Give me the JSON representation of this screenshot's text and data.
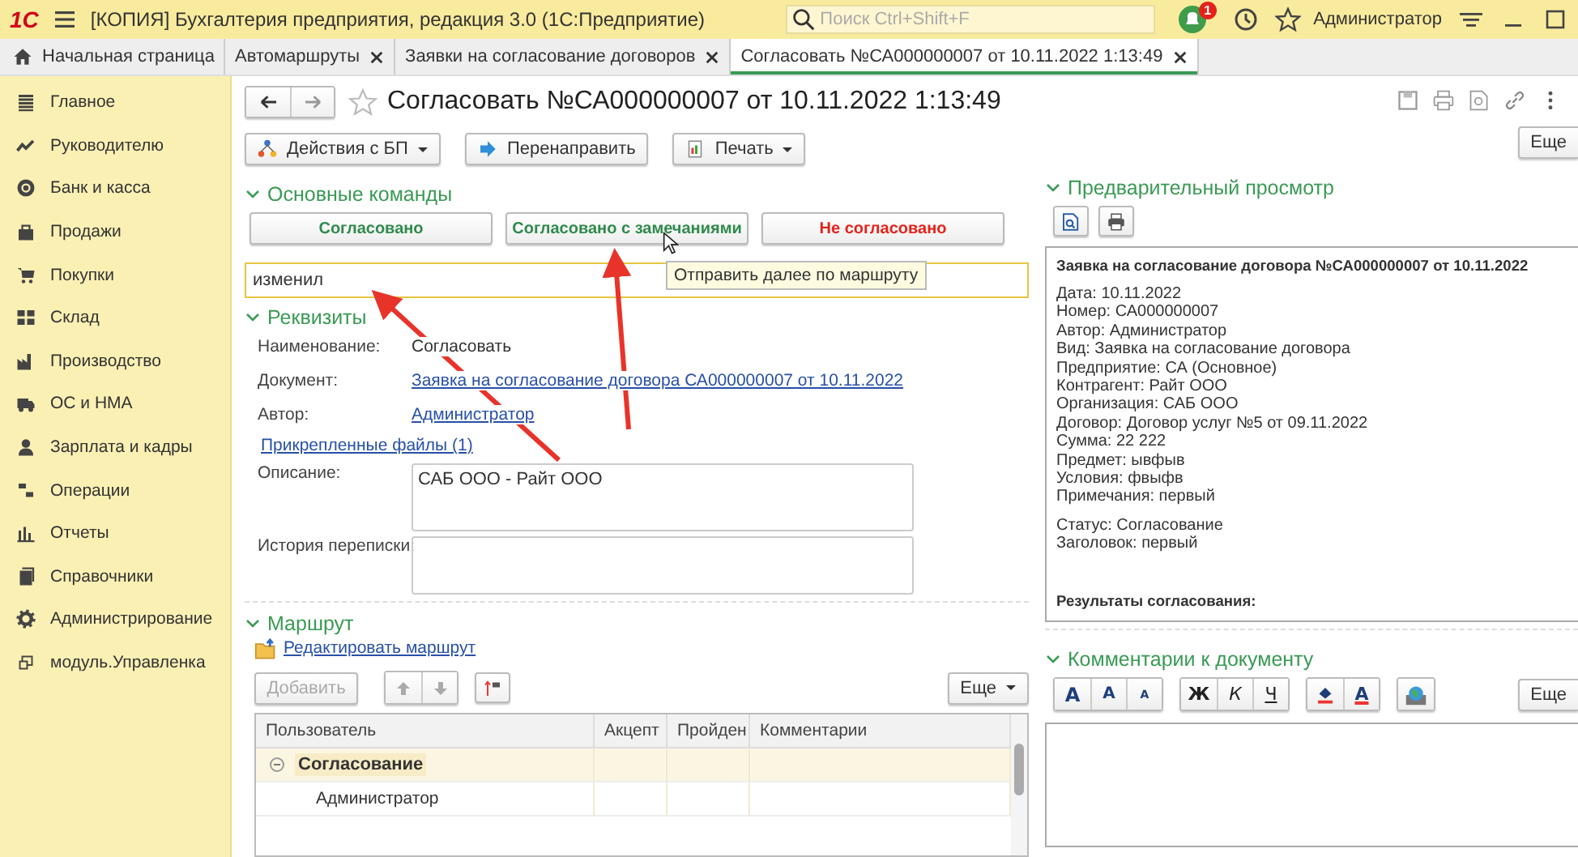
{
  "app": {
    "logo": "1С",
    "title": "[КОПИЯ] Бухгалтерия предприятия, редакция 3.0  (1С:Предприятие)",
    "search_placeholder": "Поиск Ctrl+Shift+F",
    "notifications": "1",
    "user": "Администратор"
  },
  "tabs": [
    {
      "label": "Начальная страница",
      "kind": "home",
      "selected": false
    },
    {
      "label": "Автомаршруты",
      "kind": "closable",
      "selected": false
    },
    {
      "label": "Заявки на согласование договоров",
      "kind": "closable",
      "selected": false
    },
    {
      "label": "Согласовать №СА000000007 от 10.11.2022 1:13:49",
      "kind": "closable",
      "selected": true
    }
  ],
  "sidebar": {
    "items": [
      {
        "label": "Главное",
        "kind": "list"
      },
      {
        "label": "Руководителю",
        "kind": "trend"
      },
      {
        "label": "Банк и касса",
        "kind": "coin"
      },
      {
        "label": "Продажи",
        "kind": "bag"
      },
      {
        "label": "Покупки",
        "kind": "cart"
      },
      {
        "label": "Склад",
        "kind": "grid"
      },
      {
        "label": "Производство",
        "kind": "factory"
      },
      {
        "label": "ОС и НМА",
        "kind": "truck"
      },
      {
        "label": "Зарплата и кадры",
        "kind": "person"
      },
      {
        "label": "Операции",
        "kind": "ledger"
      },
      {
        "label": "Отчеты",
        "kind": "chart"
      },
      {
        "label": "Справочники",
        "kind": "book"
      },
      {
        "label": "Администрирование",
        "kind": "gear"
      },
      {
        "label": "модуль.Управленка",
        "kind": "module"
      }
    ]
  },
  "form": {
    "title": "Согласовать №СА000000007 от 10.11.2022 1:13:49",
    "actions": [
      {
        "label": "Действия с БП",
        "kind": "bp",
        "dropdown": true
      },
      {
        "label": "Перенаправить",
        "kind": "redirect",
        "dropdown": false
      },
      {
        "label": "Печать",
        "kind": "print",
        "dropdown": true
      }
    ],
    "main_commands": {
      "header": "Основные команды",
      "buttons": [
        {
          "label": "Согласовано",
          "color": "#2f8a4c"
        },
        {
          "label": "Согласовано с замечаниями",
          "color": "#2f8a4c"
        },
        {
          "label": "Не согласовано",
          "color": "#e3231b"
        }
      ],
      "tooltip": "Отправить далее по маршруту"
    },
    "comment_field": {
      "value": "изменил"
    },
    "details": {
      "header": "Реквизиты",
      "fields": [
        {
          "label": "Наименование:",
          "value": "Согласовать",
          "kind": "text"
        },
        {
          "label": "Документ:",
          "value": "Заявка на согласование договора СА000000007 от 10.11.2022",
          "kind": "link"
        },
        {
          "label": "Автор:",
          "value": "Администратор",
          "kind": "link"
        }
      ],
      "attachments_link": "Прикрепленные файлы (1)",
      "description": {
        "label": "Описание:",
        "value": "САБ ООО - Райт ООО"
      },
      "history": {
        "label": "История переписки:"
      }
    },
    "route": {
      "header": "Маршрут",
      "edit_link": "Редактировать маршрут",
      "add_button": {
        "label": "Добавить",
        "disabled": true
      },
      "more_button": "Еще",
      "columns": [
        "Пользователь",
        "Акцепт",
        "Пройден",
        "Комментарии"
      ],
      "rows": [
        {
          "label": "Согласование",
          "expanded": true,
          "children": [
            {
              "label": "Администратор"
            }
          ]
        }
      ]
    }
  },
  "side": {
    "more_button": "Еще",
    "preview": {
      "header": "Предварительный просмотр",
      "title": "Заявка на согласование договора №СА000000007 от 10.11.2022",
      "lines": [
        "Дата: 10.11.2022",
        "Номер: СА000000007",
        "Автор: Администратор",
        "Вид: Заявка на согласование договора",
        "Предприятие: СА (Основное)",
        "Контрагент: Райт ООО",
        "Организация: САБ ООО",
        "Договор: Договор услуг №5 от 09.11.2022",
        "Сумма: 22 222",
        "Предмет: ывфыв",
        "Условия: фвыфв",
        "Примечания: первый"
      ],
      "status_lines": [
        "Статус: Согласование",
        "Заголовок: первый"
      ],
      "results": "Результаты согласования:"
    },
    "comments": {
      "header": "Комментарии к документу",
      "format_groups": [
        {
          "buttons": [
            {
              "label": "A",
              "kind": "font"
            },
            {
              "label": "A",
              "kind": "grow"
            },
            {
              "label": "A",
              "kind": "shrink"
            }
          ]
        },
        {
          "buttons": [
            {
              "label": "Ж",
              "kind": "bold"
            },
            {
              "label": "К",
              "kind": "italic"
            },
            {
              "label": "Ч",
              "kind": "underline"
            }
          ]
        },
        {
          "buttons": [
            {
              "kind": "fill"
            },
            {
              "label": "A",
              "kind": "color"
            }
          ]
        },
        {
          "buttons": [
            {
              "kind": "image"
            }
          ]
        }
      ],
      "more_button": "Еще"
    }
  }
}
